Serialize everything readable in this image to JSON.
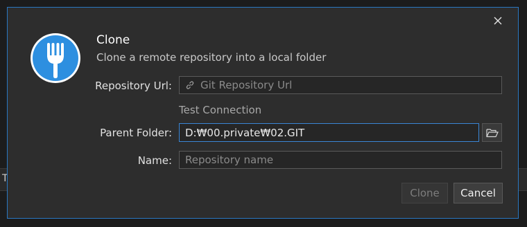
{
  "backdrop": {
    "partial_text": "T"
  },
  "dialog": {
    "title": "Clone",
    "subtitle": "Clone a remote repository into a local folder",
    "close_icon": "close-icon",
    "logo_icon": "fork-logo-icon",
    "colors": {
      "accent": "#2a78c2",
      "logo_bg": "#2d8fe0"
    }
  },
  "form": {
    "repo_url": {
      "label": "Repository Url:",
      "value": "",
      "placeholder": "Git Repository Url",
      "icon": "link-icon"
    },
    "test_connection": "Test Connection",
    "parent_folder": {
      "label": "Parent Folder:",
      "value": "D:\\00.private\\02.GIT",
      "display_value": "D:₩00.private₩02.GIT",
      "browse_icon": "folder-open-icon"
    },
    "name": {
      "label": "Name:",
      "value": "",
      "placeholder": "Repository name"
    }
  },
  "actions": {
    "clone_label": "Clone",
    "cancel_label": "Cancel"
  }
}
